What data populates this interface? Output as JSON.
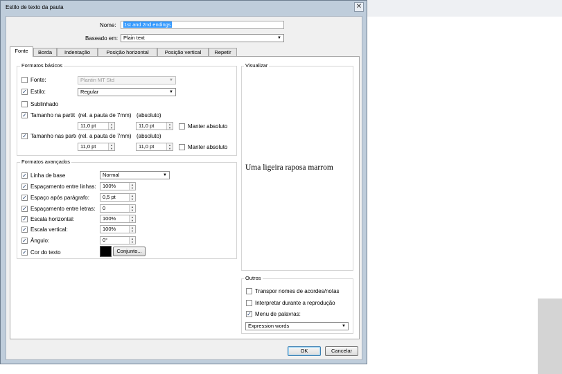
{
  "dialog": {
    "title": "Estilo de texto da pauta",
    "close_glyph": "✕"
  },
  "name_field": {
    "label": "Nome:",
    "value": "1st and 2nd endings"
  },
  "based_on": {
    "label": "Baseado em:",
    "value": "Plain text"
  },
  "tabs": [
    "Fonte",
    "Borda",
    "Indentação",
    "Posição horizontal",
    "Posição vertical",
    "Repetir"
  ],
  "basic_formats": {
    "title": "Formatos básicos",
    "font": {
      "label": "Fonte:",
      "checked": false,
      "value": "Plantin MT Std"
    },
    "style": {
      "label": "Estilo:",
      "checked": true,
      "value": "Regular"
    },
    "underline": {
      "label": "Sublinhado",
      "checked": false
    },
    "size_in_score": {
      "label": "Tamanho na partit",
      "checked": true,
      "rel_label": "(rel. a pauta de 7mm)",
      "abs_label": "(absoluto)",
      "rel_value": "11,0 pt",
      "abs_value": "11,0 pt",
      "keep_abs_label": "Manter absoluto",
      "keep_abs_checked": false
    },
    "size_in_parts": {
      "label": "Tamanho nas parte",
      "checked": true,
      "rel_label": "(rel. a pauta de 7mm)",
      "abs_label": "(absoluto)",
      "rel_value": "11,0 pt",
      "abs_value": "11,0 pt",
      "keep_abs_label": "Manter absoluto",
      "keep_abs_checked": false
    }
  },
  "advanced_formats": {
    "title": "Formatos avançados",
    "baseline": {
      "label": "Linha de base",
      "checked": true,
      "value": "Normal"
    },
    "line_spacing": {
      "label": "Espaçamento entre linhas:",
      "checked": true,
      "value": "100%"
    },
    "space_after": {
      "label": "Espaço após parágrafo:",
      "checked": true,
      "value": "0,5 pt"
    },
    "letter_spacing": {
      "label": "Espaçamento entre letras:",
      "checked": true,
      "value": "0"
    },
    "hscale": {
      "label": "Escala horizontal:",
      "checked": true,
      "value": "100%"
    },
    "vscale": {
      "label": "Escala vertical:",
      "checked": true,
      "value": "100%"
    },
    "angle": {
      "label": "Ângulo:",
      "checked": true,
      "value": "0°"
    },
    "text_color": {
      "label": "Cor do texto",
      "checked": true,
      "color": "#000000",
      "button": "Conjunto..."
    }
  },
  "preview": {
    "title": "Visualizar",
    "sample": "Uma ligeira raposa marrom"
  },
  "others": {
    "title": "Outros",
    "transpose": {
      "label": "Transpor nomes de acordes/notas",
      "checked": false
    },
    "interpret": {
      "label": "Interpretar durante a reprodução",
      "checked": false
    },
    "word_menu": {
      "label": "Menu de palavras:",
      "checked": true,
      "value": "Expression words"
    }
  },
  "buttons": {
    "ok": "OK",
    "cancel": "Cancelar"
  },
  "checkmark_glyph": "✓",
  "dropdown_glyph": "▼",
  "spin_glyphs": {
    "up": "▲",
    "down": "▼"
  }
}
